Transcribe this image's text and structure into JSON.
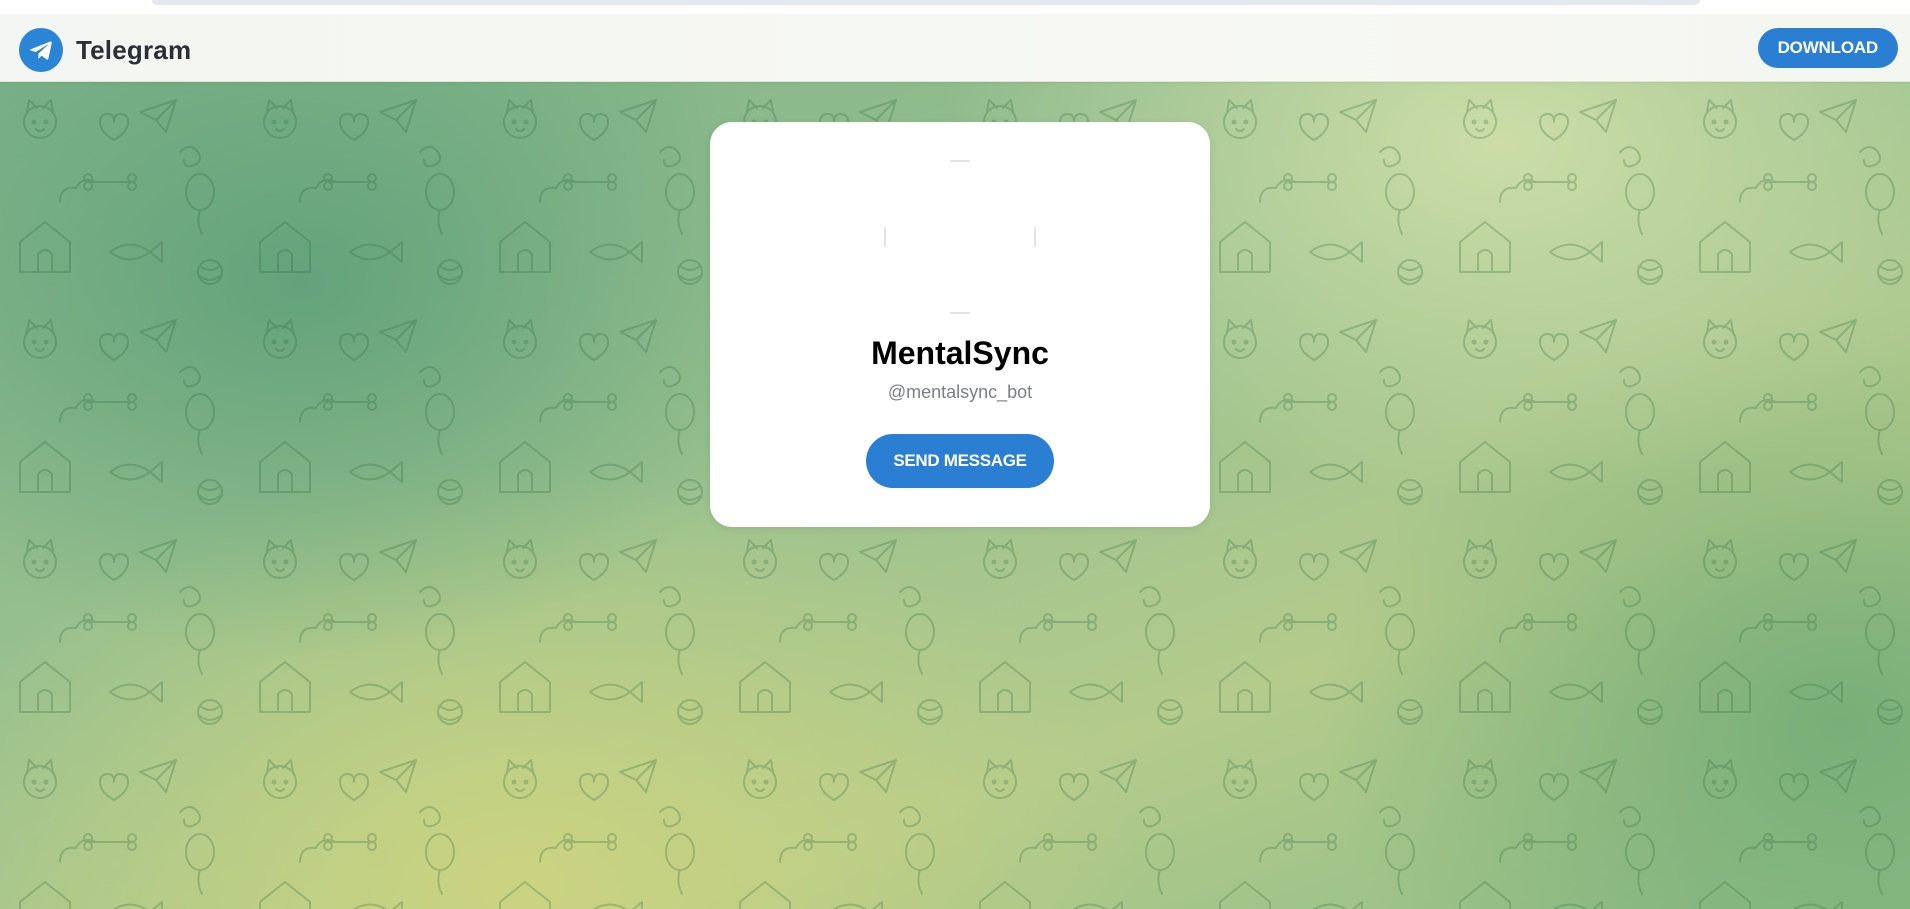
{
  "header": {
    "brand_name": "Telegram",
    "logo_icon": "telegram-plane-icon",
    "download_label": "DOWNLOAD"
  },
  "profile": {
    "name": "MentalSync",
    "username": "@mentalsync_bot",
    "send_label": "SEND MESSAGE",
    "avatar_icon": "bot-avatar"
  },
  "background": {
    "pattern_icons": [
      "cat-icon",
      "dog-icon",
      "paper-plane-icon",
      "balloon-icon",
      "doghouse-icon",
      "bone-icon",
      "fish-icon",
      "yarn-ball-icon",
      "cloud-icon",
      "heart-icon"
    ]
  },
  "colors": {
    "accent": "#2a7fd3",
    "logo": "#2a85d6",
    "card": "#ffffff",
    "bg_green": "#7fb38a",
    "bg_yellow": "#cdd480"
  }
}
